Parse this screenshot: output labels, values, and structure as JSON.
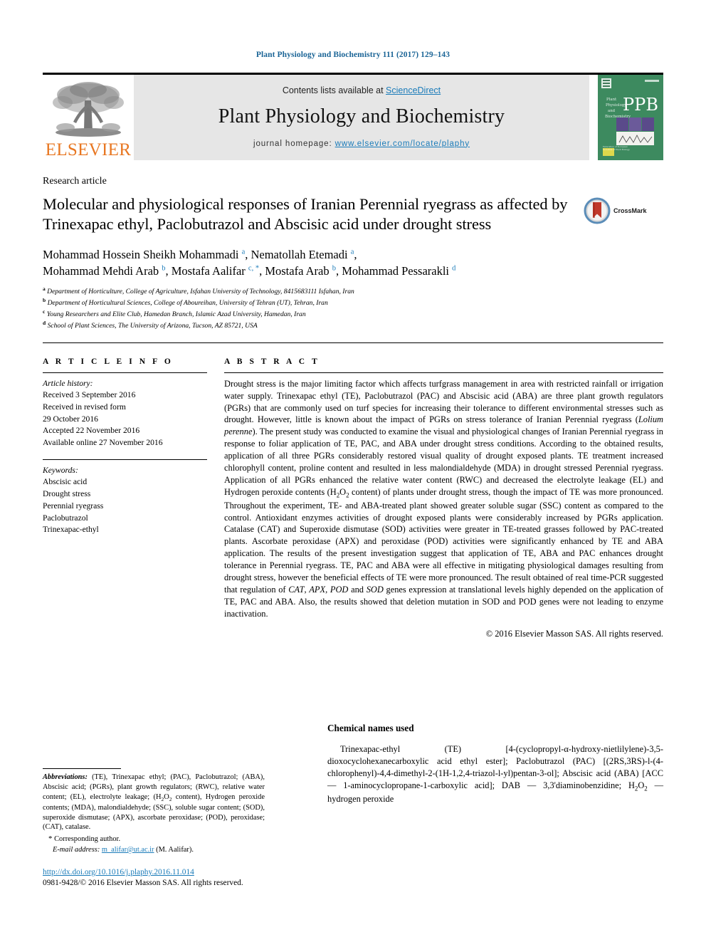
{
  "running_head": "Plant Physiology and Biochemistry 111 (2017) 129–143",
  "masthead": {
    "publisher_name": "ELSEVIER",
    "contents_prefix": "Contents lists available at ",
    "sciencedirect": "ScienceDirect",
    "journal_title": "Plant Physiology and Biochemistry",
    "homepage_prefix": "journal homepage: ",
    "homepage_url": "www.elsevier.com/locate/plaphy",
    "cover_abbrev": "PPB",
    "cover_side_text": "Plant Physiology and Biochemistry",
    "cover_bg": "#3d8a5f"
  },
  "article_type": "Research article",
  "title": "Molecular and physiological responses of Iranian Perennial ryegrass as affected by Trinexapac ethyl, Paclobutrazol and Abscisic acid under drought stress",
  "crossmark_label": "CrossMark",
  "authors_line_1": "Mohammad Hossein Sheikh Mohammadi <sup>a</sup>, Nematollah Etemadi <sup>a</sup>,",
  "authors_line_2": "Mohammad Mehdi Arab <sup>b</sup>, Mostafa Aalifar <sup>c, *</sup>, Mostafa Arab <sup>b</sup>, Mohammad Pessarakli <sup>d</sup>",
  "affiliations": [
    {
      "marker": "a",
      "text": "Department of Horticulture, College of Agriculture, Isfahan University of Technology, 8415683111 Isfahan, Iran"
    },
    {
      "marker": "b",
      "text": "Department of Horticultural Sciences, College of Aboureihan, University of Tehran (UT), Tehran, Iran"
    },
    {
      "marker": "c",
      "text": "Young Researchers and Elite Club, Hamedan Branch, Islamic Azad University, Hamedan, Iran"
    },
    {
      "marker": "d",
      "text": "School of Plant Sciences, The University of Arizona, Tucson, AZ 85721, USA"
    }
  ],
  "article_info": {
    "heading": "A R T I C L E  I N F O",
    "history_label": "Article history:",
    "history": [
      "Received 3 September 2016",
      "Received in revised form",
      "29 October 2016",
      "Accepted 22 November 2016",
      "Available online 27 November 2016"
    ],
    "keywords_label": "Keywords:",
    "keywords": [
      "Abscisic acid",
      "Drought stress",
      "Perennial ryegrass",
      "Paclobutrazol",
      "Trinexapac-ethyl"
    ]
  },
  "abstract": {
    "heading": "A B S T R A C T",
    "text": "Drought stress is the major limiting factor which affects turfgrass management in area with restricted rainfall or irrigation water supply. Trinexapac ethyl (TE), Paclobutrazol (PAC) and Abscisic acid (ABA) are three plant growth regulators (PGRs) that are commonly used on turf species for increasing their tolerance to different environmental stresses such as drought. However, little is known about the impact of PGRs on stress tolerance of Iranian Perennial ryegrass (<i>Lolium perenne</i>). The present study was conducted to examine the visual and physiological changes of Iranian Perennial ryegrass in response to foliar application of TE, PAC, and ABA under drought stress conditions. According to the obtained results, application of all three PGRs considerably restored visual quality of drought exposed plants. TE treatment increased chlorophyll content, proline content and resulted in less malondialdehyde (MDA) in drought stressed Perennial ryegrass. Application of all PGRs enhanced the relative water content (RWC) and decreased the electrolyte leakage (EL) and Hydrogen peroxide contents (H<sub>2</sub>O<sub>2</sub> content) of plants under drought stress, though the impact of TE was more pronounced. Throughout the experiment, TE- and ABA-treated plant showed greater soluble sugar (SSC) content as compared to the control. Antioxidant enzymes activities of drought exposed plants were considerably increased by PGRs application. Catalase (CAT) and Superoxide dismutase (SOD) activities were greater in TE-treated grasses followed by PAC-treated plants. Ascorbate peroxidase (APX) and peroxidase (POD) activities were significantly enhanced by TE and ABA application. The results of the present investigation suggest that application of TE, ABA and PAC enhances drought tolerance in Perennial ryegrass. TE, PAC and ABA were all effective in mitigating physiological damages resulting from drought stress, however the beneficial effects of TE were more pronounced. The result obtained of real time-PCR suggested that regulation of <i>CAT</i>, <i>APX</i>, <i>POD</i> and <i>SOD</i> genes expression at translational levels highly depended on the application of TE, PAC and ABA. Also, the results showed that deletion mutation in SOD and POD genes were not leading to enzyme inactivation.",
    "copyright": "© 2016 Elsevier Masson SAS. All rights reserved."
  },
  "footnotes": {
    "abbreviations_label": "Abbreviations:",
    "abbreviations_text": " (TE), Trinexapac ethyl; (PAC), Paclobutrazol; (ABA), Abscisic acid; (PGRs), plant growth regulators; (RWC), relative water content; (EL), electrolyte leakage; (H<sub>2</sub>O<sub>2</sub> content), Hydrogen peroxide contents; (MDA), malondialdehyde; (SSC), soluble sugar content; (SOD), superoxide dismutase; (APX), ascorbate peroxidase; (POD), peroxidase; (CAT), catalase.",
    "corresponding_author": "Corresponding author.",
    "email_label": "E-mail address:",
    "email": "m_alifar@ut.ac.ir",
    "email_suffix": " (M. Aalifar)."
  },
  "chemical_names": {
    "heading": "Chemical names used",
    "text": "Trinexapac-ethyl (TE) [4-(cyclopropyl-α-hydroxy-nietlilylene)-3,5-dioxocyclohexanecarboxylic acid ethyl ester]; Paclobutrazol (PAC) [(2RS,3RS)-l-(4-chlorophenyl)-4,4-dimethyl-2-(1H-1,2,4-triazol-l-yl)pentan-3-ol]; Abscisic acid (ABA) [ACC — 1-aminocyclopropane-1-carboxylic acid]; DAB — 3,3'diaminobenzidine; H<sub>2</sub>O<sub>2</sub> — hydrogen peroxide"
  },
  "footer": {
    "doi": "http://dx.doi.org/10.1016/j.plaphy.2016.11.014",
    "issn_line": "0981-9428/© 2016 Elsevier Masson SAS. All rights reserved."
  },
  "colors": {
    "link": "#1a7bb9",
    "running_head": "#1a6496",
    "elsevier_orange": "#E87722",
    "band_gray": "#e6e6e6"
  }
}
